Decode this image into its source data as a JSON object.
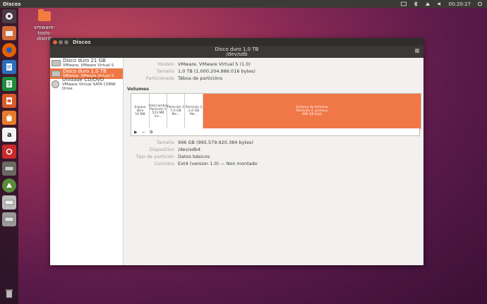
{
  "top_panel": {
    "app_title": "Discos",
    "time": "00:20:27"
  },
  "desktop": {
    "folder_label_1": "vmware-tools-",
    "folder_label_2": "distrib"
  },
  "window": {
    "title": "Discos",
    "header_line1": "Disco duro 1,0 TB",
    "header_line2": "/dev/sdb"
  },
  "sidebar": {
    "items": [
      {
        "name": "Disco duro 21 GB",
        "sub": "VMware, VMware Virtual S"
      },
      {
        "name": "Disco duro 1,0 TB",
        "sub": "VMware, VMware Virtual S"
      },
      {
        "name": "Unidade CD/DVD",
        "sub": "VMware Virtual SATA CDRW Drive"
      }
    ]
  },
  "disk_info": {
    "model_label": "Modelo",
    "model_value": "VMware, VMware Virtual S (1.0)",
    "size_label": "Tamaño",
    "size_value": "1,0 TB (1.000.204.886.016 bytes)",
    "partitioning_label": "Particionado",
    "partitioning_value": "Táboa de particións"
  },
  "volumes": {
    "title": "Volumes",
    "partitions": [
      {
        "line1": "Espazo libre",
        "line2": "16 MB",
        "line3": ""
      },
      {
        "line1": "Intercambio",
        "line2": "Partición 5",
        "line3": "523 MB Ire..."
      },
      {
        "line1": "Partición 3",
        "line2": "7,0 GB Me...",
        "line3": ""
      },
      {
        "line1": "Partición 2",
        "line2": "2,0 GB Me...",
        "line3": ""
      },
      {
        "line1": "Sistema de ficheiros",
        "line2": "Partición 4: primary",
        "line3": "996 GB Ext4"
      }
    ]
  },
  "volume_info": {
    "size_label": "Tamaño",
    "size_value": "996 GB (995.579.920.384 bytes)",
    "device_label": "Dispositivo",
    "device_value": "/dev/sdb4",
    "ptype_label": "Tipo de partición",
    "ptype_value": "Datos básicos",
    "contents_label": "Contidos",
    "contents_value": "Ext4 (version 1.0) — Non montado"
  },
  "toolbar": {
    "play": "▶",
    "minus": "−",
    "settings": "⚙"
  },
  "colors": {
    "accent": "#f07746",
    "panel": "#3b3a37"
  }
}
